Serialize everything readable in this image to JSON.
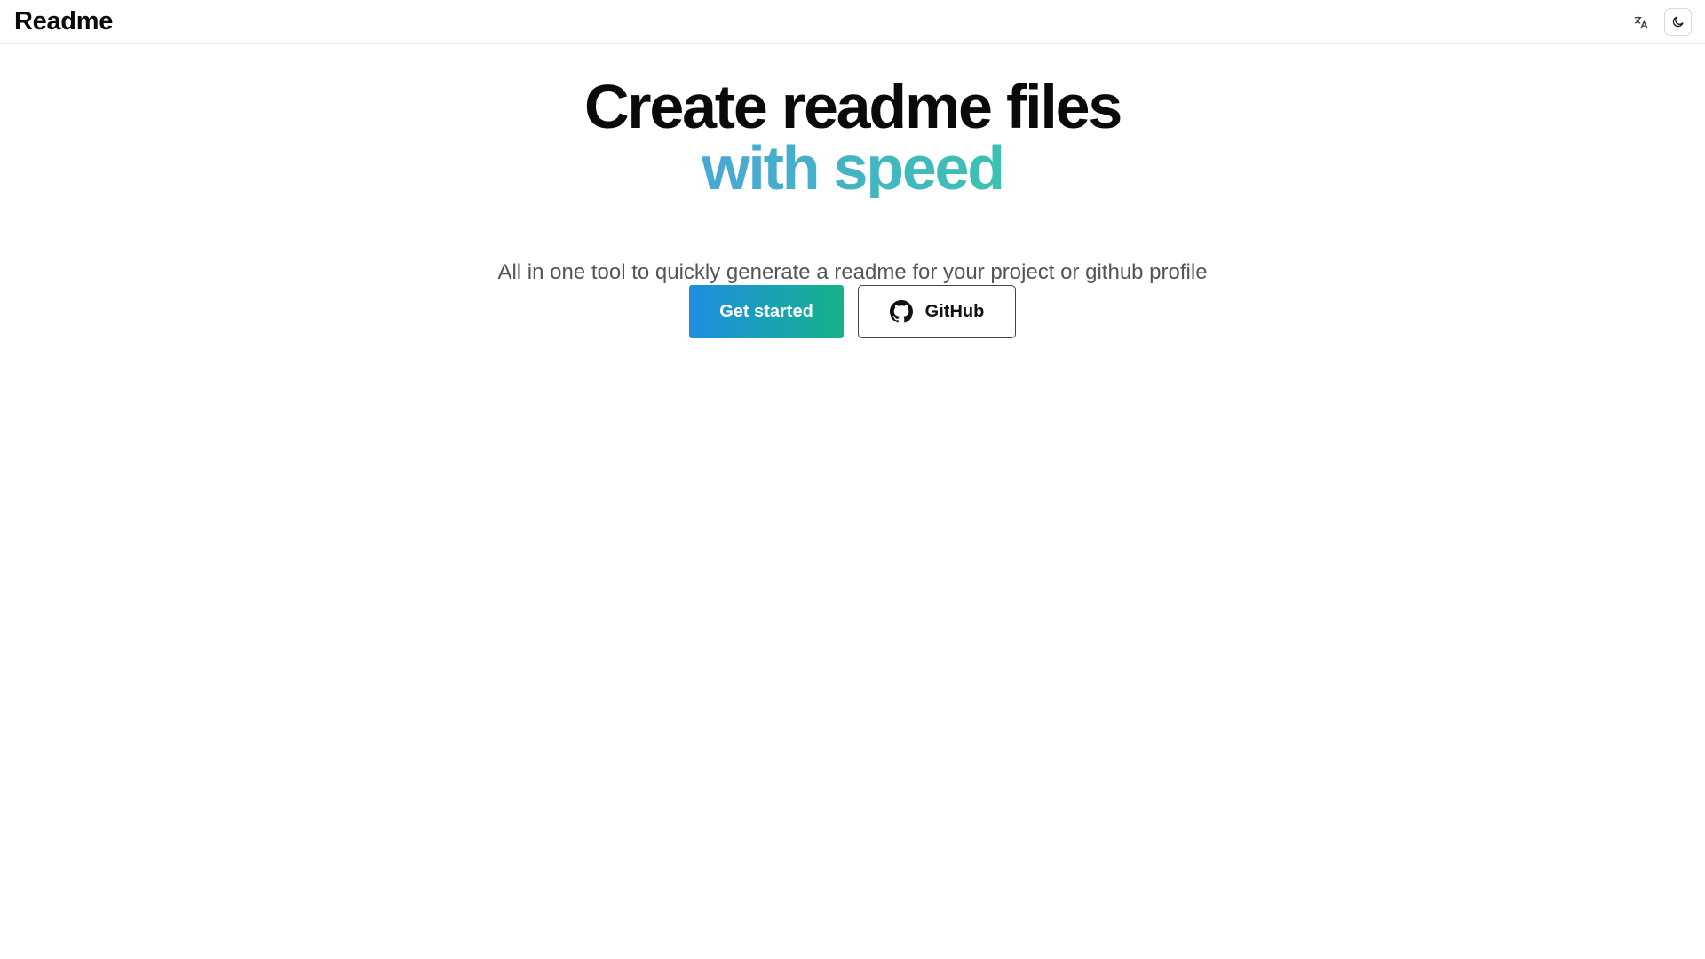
{
  "header": {
    "logo_text": "Readme",
    "language_icon": "translate-icon",
    "theme_icon": "moon-icon"
  },
  "hero": {
    "headline_line1": "Create readme files",
    "headline_line2": "with speed",
    "subtitle": "All in one tool to quickly generate a readme for your project or github profile"
  },
  "actions": {
    "primary_label": "Get started",
    "secondary_label": "GitHub",
    "secondary_icon": "github-icon"
  },
  "colors": {
    "accent_gradient_start": "#1f8ee2",
    "accent_gradient_end": "#15b28a",
    "headline_gradient_start": "#4aa7d6",
    "headline_gradient_end": "#3cc2b1"
  }
}
